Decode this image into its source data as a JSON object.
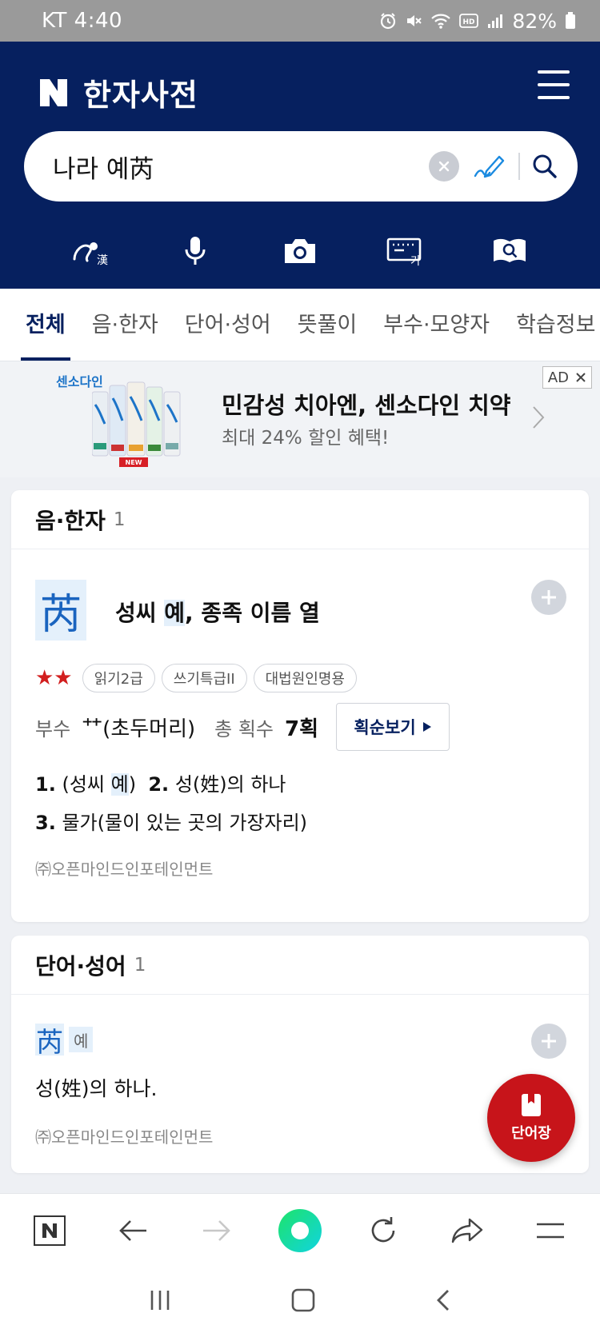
{
  "status_bar": {
    "carrier_time": "KT 4:40",
    "battery": "82%"
  },
  "header": {
    "logo_letter": "N",
    "title": "한자사전"
  },
  "search": {
    "value": "나라 예芮",
    "placeholder": ""
  },
  "tool_icons": [
    "handwriting-hanja-icon",
    "microphone-icon",
    "camera-icon",
    "keyboard-icon",
    "book-search-icon"
  ],
  "tabs": [
    {
      "label": "전체",
      "active": true
    },
    {
      "label": "음·한자",
      "active": false
    },
    {
      "label": "단어·성어",
      "active": false
    },
    {
      "label": "뜻풀이",
      "active": false
    },
    {
      "label": "부수·모양자",
      "active": false
    },
    {
      "label": "학습정보",
      "active": false
    }
  ],
  "ad": {
    "brand": "센소다인",
    "title": "민감성 치아엔, 센소다인 치약",
    "subtitle": "최대 24% 할인 혜택!",
    "tag": "AD"
  },
  "hanja_section": {
    "title": "음·한자",
    "count": "1",
    "char": "芮",
    "meaning_prefix": "성씨 ",
    "meaning_highlight": "예",
    "meaning_suffix": ", 종족 이름 열",
    "stars": "★★",
    "badges": [
      "읽기2급",
      "쓰기특급II",
      "대법원인명용"
    ],
    "radical_label": "부수",
    "radical_value": "⺿(초두머리)",
    "strokes_label": "총 획수",
    "strokes_value": "7획",
    "stroke_order_button": "획순보기",
    "def1_num": "1.",
    "def1_open": "(성씨 ",
    "def1_hl": "예",
    "def1_close": ")",
    "def2_num": "2.",
    "def2_text": "성(姓)의 하나",
    "def3_num": "3.",
    "def3_text": "물가(물이 있는 곳의 가장자리)",
    "source": "㈜오픈마인드인포테인먼트"
  },
  "word_section": {
    "title": "단어·성어",
    "count": "1",
    "word": "芮",
    "reading": "예",
    "definition": "성(姓)의 하나.",
    "source": "㈜오픈마인드인포테인먼트"
  },
  "fab": {
    "label": "단어장"
  },
  "colors": {
    "header_bg": "#06205f",
    "accent_blue": "#1a64bf",
    "highlight_bg": "#e4f0fb",
    "fab_red": "#c7141a",
    "star_red": "#d21f1f",
    "home_green": "#1ee3a0"
  }
}
